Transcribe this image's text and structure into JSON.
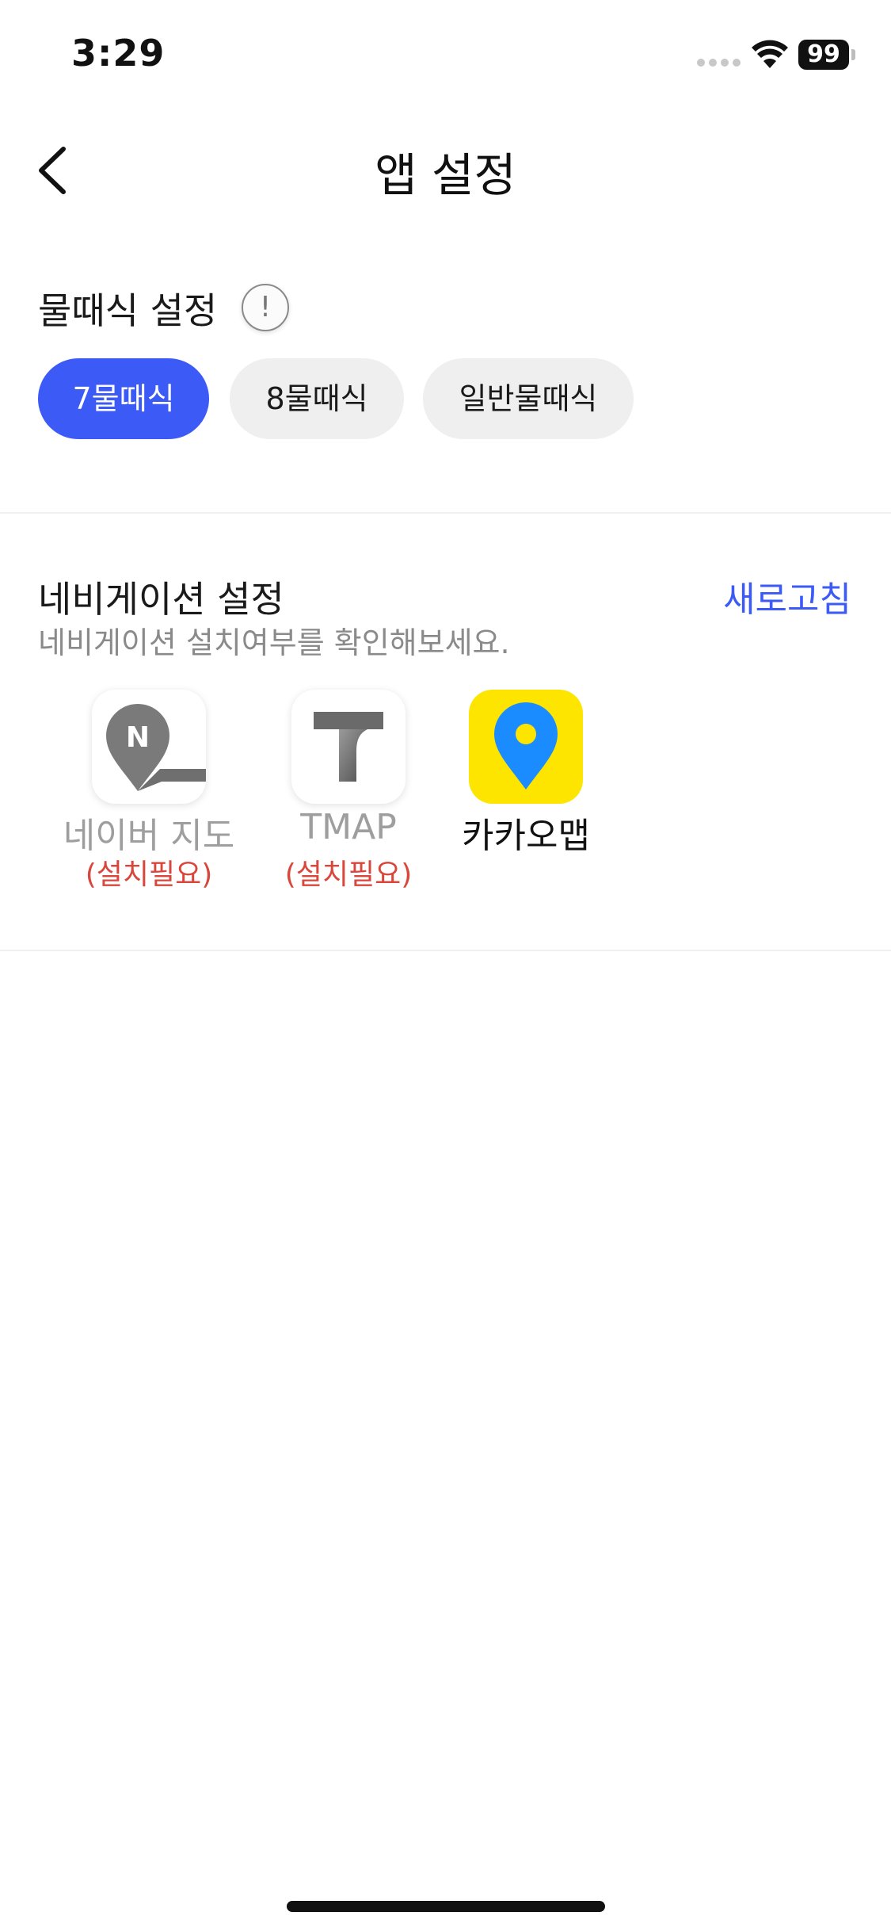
{
  "status_bar": {
    "time": "3:29",
    "battery": "99"
  },
  "header": {
    "title": "앱 설정",
    "back_icon": "chevron-left-icon"
  },
  "tide_section": {
    "title": "물때식 설정",
    "info_icon": "!",
    "options": [
      {
        "label": "7물때식",
        "selected": true
      },
      {
        "label": "8물때식",
        "selected": false
      },
      {
        "label": "일반물때식",
        "selected": false
      }
    ]
  },
  "navigation_section": {
    "title": "네비게이션 설정",
    "refresh_label": "새로고침",
    "subtitle": "네비게이션 설치여부를 확인해보세요.",
    "apps": [
      {
        "name": "네이버 지도",
        "status": "(설치필요)",
        "installed": false,
        "icon": "naver-map-icon"
      },
      {
        "name": "TMAP",
        "status": "(설치필요)",
        "installed": false,
        "icon": "tmap-icon"
      },
      {
        "name": "카카오맵",
        "status": "",
        "installed": true,
        "icon": "kakao-map-icon"
      }
    ]
  },
  "colors": {
    "accent": "#3b5af6",
    "chip_inactive": "#efefef",
    "warning": "#d9473c",
    "kakao_yellow": "#fde500",
    "kakao_blue": "#1a8cff"
  }
}
